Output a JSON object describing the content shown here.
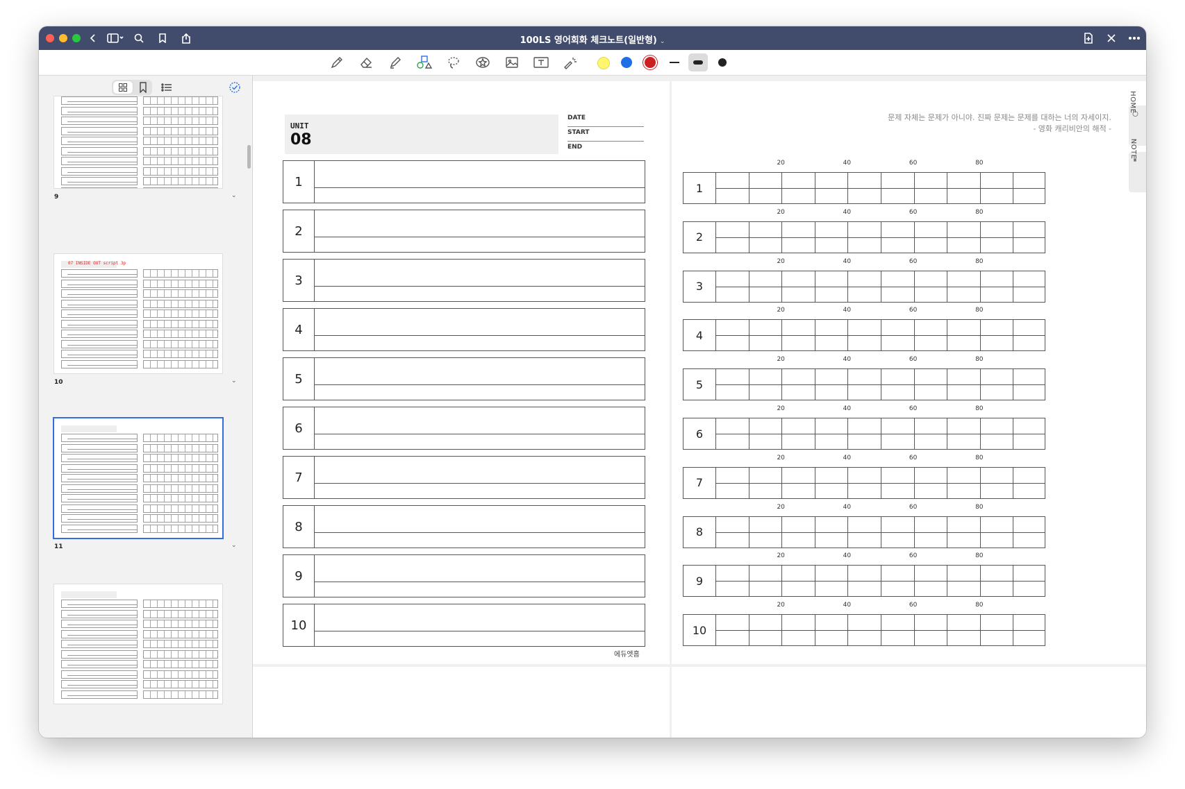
{
  "window": {
    "title": "100LS 영어회화 체크노트(일반형)"
  },
  "titlebar_icons": [
    "back-icon",
    "sidebar-toggle-icon",
    "search-icon",
    "bookmark-icon",
    "share-icon",
    "add-page-icon",
    "close-icon",
    "more-icon"
  ],
  "toolbar": {
    "tools": [
      "pencil-icon",
      "eraser-icon",
      "highlighter-icon",
      "shapes-icon",
      "lasso-icon",
      "sticker-icon",
      "image-icon",
      "text-box-icon",
      "laser-pointer-icon"
    ],
    "colors": [
      "#fff66e",
      "#1e6fe6",
      "#cc1f1f"
    ],
    "selected_thickness": "medium"
  },
  "sidebar": {
    "thumbnails": [
      {
        "label": "9",
        "selected": false
      },
      {
        "label": "10",
        "selected": false,
        "script_text": "07  INSIDE OUT script 3p",
        "line1": "I'm gonna make sure that tomorrow is another great day."
      },
      {
        "label": "11",
        "selected": true
      },
      {
        "label": "",
        "selected": false
      }
    ]
  },
  "left_page": {
    "unit_label": "UNIT",
    "unit_number": "08",
    "meta": [
      "DATE",
      "START",
      "END"
    ],
    "rows": [
      "1",
      "2",
      "3",
      "4",
      "5",
      "6",
      "7",
      "8",
      "9",
      "10"
    ],
    "footer": "에듀엣홈"
  },
  "right_page": {
    "quote_line1": "문제 자체는 문제가 아니야. 진짜 문제는 문제를 대하는 너의 자세이지.",
    "quote_line2": "- 영화 캐리비안의 해적 -",
    "tabs": [
      "HOME",
      "NOTE"
    ],
    "ticks": [
      "20",
      "40",
      "60",
      "80"
    ],
    "rows": [
      "1",
      "2",
      "3",
      "4",
      "5",
      "6",
      "7",
      "8",
      "9",
      "10"
    ],
    "cells_per_row": 10
  }
}
